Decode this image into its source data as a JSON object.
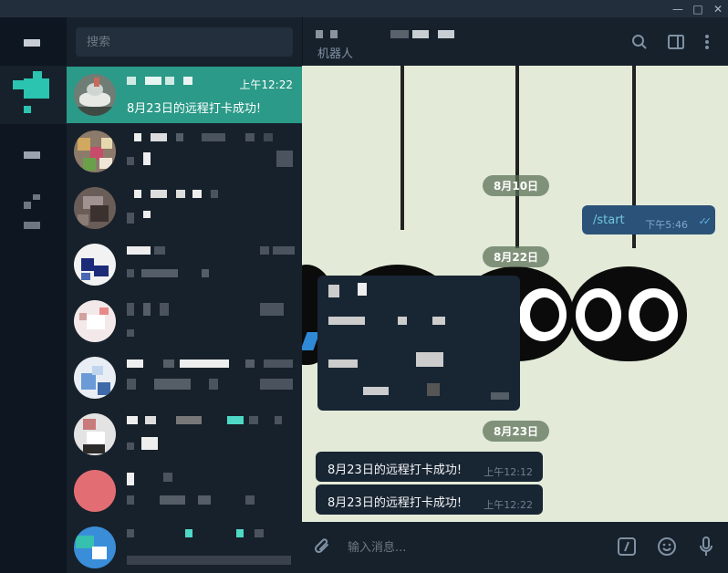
{
  "window": {
    "minimize": "—",
    "maximize": "□",
    "close": "✕"
  },
  "search": {
    "placeholder": "搜索"
  },
  "chats": [
    {
      "time": "上午12:22",
      "preview": "8月23日的远程打卡成功!"
    }
  ],
  "header": {
    "status": "机器人"
  },
  "icons": {
    "search": "search-icon",
    "sidebar": "sidebar-toggle-icon",
    "more": "more-vert-icon",
    "attach": "paperclip-icon",
    "commands": "slash-command-icon",
    "emoji": "emoji-icon",
    "mic": "microphone-icon"
  },
  "messages": {
    "date1": "8月10日",
    "out1": {
      "text": "/start",
      "time": "下午5:46"
    },
    "date2": "8月22日",
    "date3": "8月23日",
    "in1": {
      "text": "8月23日的远程打卡成功!",
      "time": "上午12:12"
    },
    "in2": {
      "text": "8月23日的远程打卡成功!",
      "time": "上午12:22"
    }
  },
  "composer": {
    "placeholder": "输入消息..."
  },
  "colors": {
    "accent": "#2b9a88",
    "sidebar_bg": "#17212b",
    "chat_bg": "#e3ebd8",
    "bubble_in": "#182533",
    "bubble_out": "#2b5278"
  }
}
